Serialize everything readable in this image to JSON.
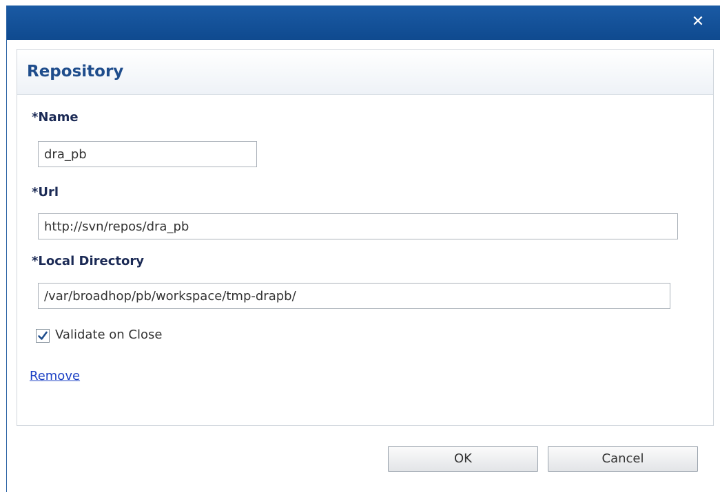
{
  "dialog": {
    "close_symbol": "✕"
  },
  "panel": {
    "title": "Repository"
  },
  "form": {
    "name_label": "*Name",
    "name_value": "dra_pb",
    "url_label": "*Url",
    "url_value": "http://svn/repos/dra_pb",
    "localdir_label": "*Local Directory",
    "localdir_value": "/var/broadhop/pb/workspace/tmp-drapb/",
    "validate_label": "Validate on Close",
    "validate_checked": true,
    "remove_link": "Remove"
  },
  "buttons": {
    "ok": "OK",
    "cancel": "Cancel"
  },
  "colors": {
    "titlebar": "#1a5aa4",
    "title_text": "#1f4d8c",
    "link": "#1a3fc4"
  },
  "icons": {
    "close": "close-icon",
    "check": "checkmark-icon"
  }
}
